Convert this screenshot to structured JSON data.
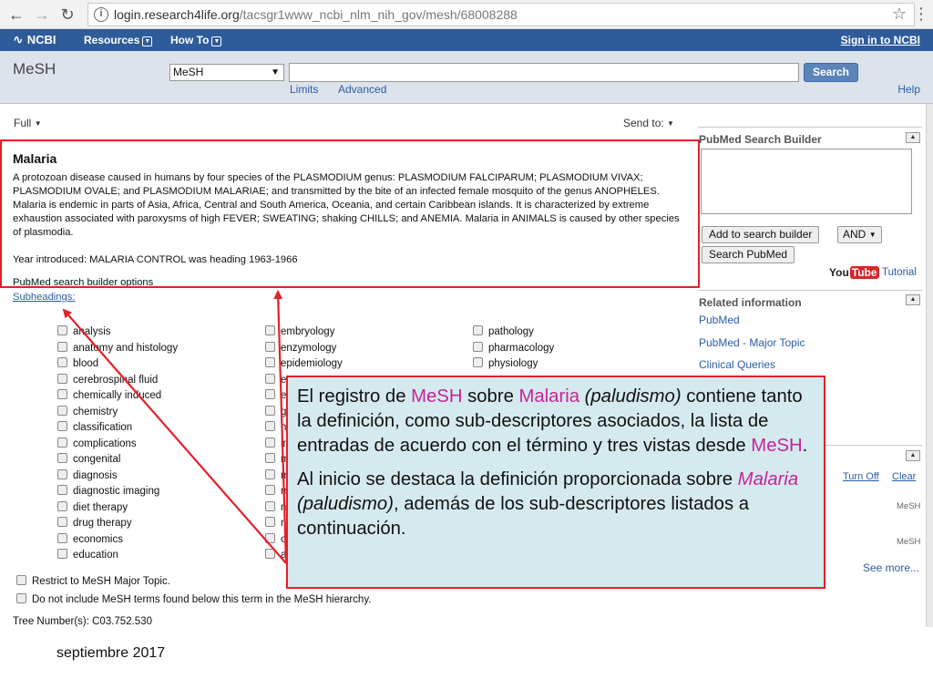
{
  "browser": {
    "url_host": "login.research4life.org",
    "url_path": "/tacsgr1www_ncbi_nlm_nih_gov/mesh/68008288",
    "icons": [
      "arrow-left-icon",
      "arrow-right-icon",
      "reload-icon",
      "info-icon",
      "star-icon",
      "menu-icon"
    ]
  },
  "ncbi_bar": {
    "logo": "NCBI",
    "menus": [
      "Resources",
      "How To"
    ],
    "signin": "Sign in to NCBI",
    "color": "#2e5b9a"
  },
  "search": {
    "db_title": "MeSH",
    "db_selected": "MeSH",
    "query": "",
    "button": "Search",
    "limits": "Limits",
    "advanced": "Advanced",
    "help": "Help"
  },
  "display": {
    "format": "Full",
    "send_to": "Send to:"
  },
  "record": {
    "title": "Malaria",
    "definition": "A protozoan disease caused in humans by four species of the PLASMODIUM genus: PLASMODIUM FALCIPARUM; PLASMODIUM VIVAX; PLASMODIUM OVALE; and PLASMODIUM MALARIAE; and transmitted by the bite of an infected female mosquito of the genus ANOPHELES. Malaria is endemic in parts of Asia, Africa, Central and South America, Oceania, and certain Caribbean islands. It is characterized by extreme exhaustion associated with paroxysms of high FEVER; SWEATING; shaking CHILLS; and ANEMIA. Malaria in ANIMALS is caused by other species of plasmodia.",
    "year_introduced": "Year introduced: MALARIA CONTROL was heading 1963-1966",
    "builder_options": "PubMed search builder options",
    "subheadings_label": "Subheadings:",
    "subheadings_col1": [
      "analysis",
      "anatomy and histology",
      "blood",
      "cerebrospinal fluid",
      "chemically induced",
      "chemistry",
      "classification",
      "complications",
      "congenital",
      "diagnosis",
      "diagnostic imaging",
      "diet therapy",
      "drug therapy",
      "economics",
      "education"
    ],
    "subheadings_col2": [
      "embryology",
      "enzymology",
      "epidemiology",
      "e",
      "e",
      "g",
      "h",
      "in",
      "m",
      "m",
      "m",
      "n",
      "n",
      "o",
      "admi"
    ],
    "subheadings_col3": [
      "pathology",
      "pharmacology",
      "physiology"
    ],
    "restrict_major": "Restrict to MeSH Major Topic.",
    "no_explode": "Do not include MeSH terms found below this term in the MeSH hierarchy.",
    "tree_number": "Tree Number(s): C03.752.530"
  },
  "sidebar": {
    "builder_heading": "PubMed Search Builder",
    "add_button": "Add to search builder",
    "operator": "AND",
    "search_pubmed": "Search PubMed",
    "youtube_you": "You",
    "youtube_tube": "Tube",
    "tutorial": "Tutorial",
    "related_heading": "Related information",
    "related_links": [
      "PubMed",
      "PubMed - Major Topic",
      "Clinical Queries"
    ],
    "turn_off": "Turn Off",
    "clear": "Clear",
    "recent_db": [
      "MeSH",
      "MeSH"
    ],
    "see_more": "See more..."
  },
  "callout": {
    "p1_a": "El registro de ",
    "p1_mesh": "MeSH",
    "p1_b": " sobre ",
    "p1_malaria": "Malaria",
    "p1_c": " ",
    "p1_paludismo": "(paludismo)",
    "p1_d": " contiene tanto la definición, como sub-descriptores asociados, la lista de entradas de acuerdo con el término y tres vistas desde ",
    "p1_mesh2": "MeSH",
    "p1_e": ".",
    "p2_a": "Al inicio se destaca la definición proporcionada sobre ",
    "p2_malaria": "Malaria",
    "p2_b": " ",
    "p2_paludismo": "(paludismo)",
    "p2_c": ", además de los sub-descriptores listados a continuación.",
    "highlight_color": "#c7239a",
    "border_color": "#e2212b",
    "fill_color": "#d5eaee"
  },
  "footer": {
    "date": "septiembre 2017"
  }
}
